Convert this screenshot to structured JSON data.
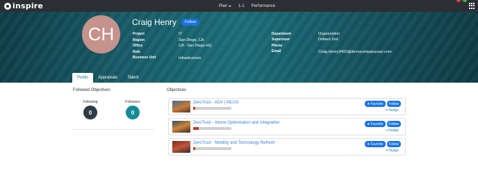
{
  "brand": {
    "name": "inspire"
  },
  "topnav": {
    "items": [
      {
        "label": "Plan",
        "has_caret": true
      },
      {
        "label": "1-1"
      },
      {
        "label": "Performance"
      }
    ]
  },
  "profile": {
    "initials": "CH",
    "name": "Craig Henry",
    "follow_label": "Follow",
    "left_fields": [
      {
        "label": "Project",
        "value": "IT"
      },
      {
        "label": "Region",
        "value": "San Diego, CA"
      },
      {
        "label": "Office",
        "value": "CA - San Diego HQ"
      },
      {
        "label": "Role",
        "value": ""
      },
      {
        "label": "Business Unit",
        "value": "Infrastructure"
      }
    ],
    "right_fields": [
      {
        "label": "Department",
        "value": "Organization"
      },
      {
        "label": "Supervisor",
        "value": "Delbert Zed"
      },
      {
        "label": "Phone",
        "value": ""
      },
      {
        "label": "Email",
        "value": "Craig.Henry3402@democompanyuser.com"
      }
    ]
  },
  "tabs": [
    {
      "label": "Public",
      "active": true
    },
    {
      "label": "Appraisals"
    },
    {
      "label": "Talent"
    }
  ],
  "followed": {
    "title": "Followed Objectives",
    "following_label": "Following",
    "following_count": "0",
    "followers_label": "Followers",
    "followers_count": "0"
  },
  "objectives": {
    "title": "Objectives",
    "favorite_label": "Favorite",
    "follow_label": "Follow",
    "nudge_label": "Nudge",
    "items": [
      {
        "title": "ZeroTrust - ADV | MCAS",
        "progress": 0.05
      },
      {
        "title": "ZeroTrust - Intune Optimization and Integration",
        "progress": 0.15
      },
      {
        "title": "ZeroTrust - Mobility and Technology Refresh",
        "progress": 0.05
      }
    ]
  },
  "colors": {
    "accent": "#1a73e8",
    "dark_circle": "#2f3b44",
    "teal_circle": "#178a98",
    "topbar": "#2b2f33"
  }
}
